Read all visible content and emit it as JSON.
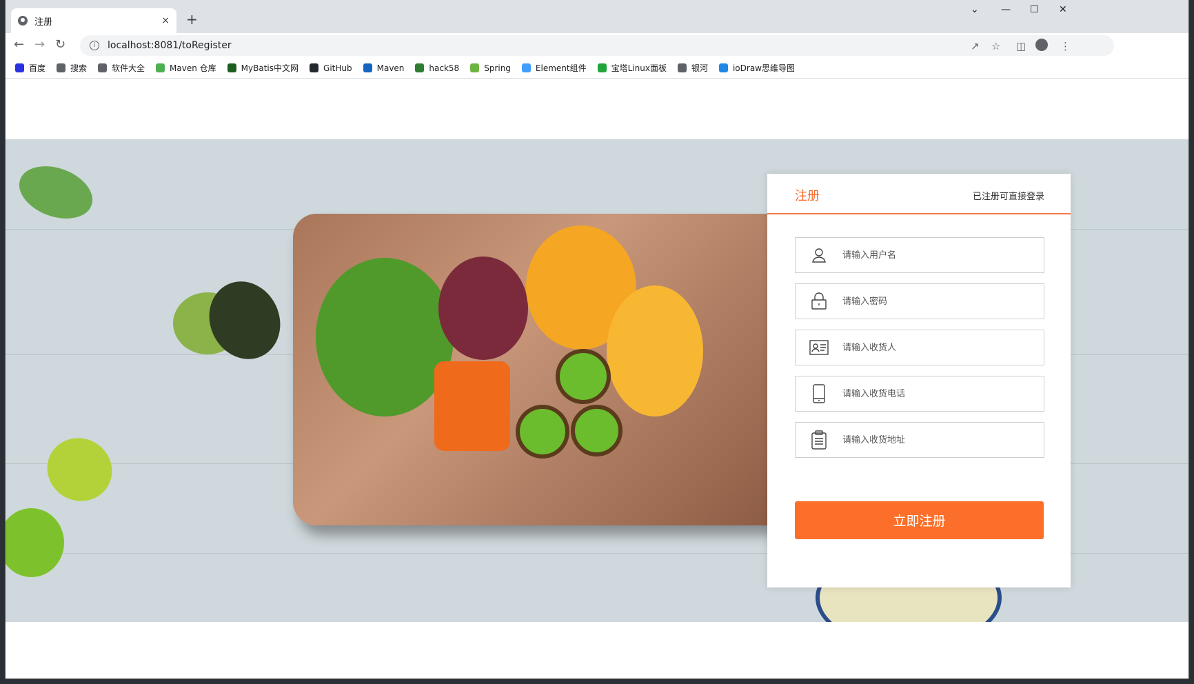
{
  "browser": {
    "tab_title": "注册",
    "tab_close": "×",
    "new_tab": "+",
    "url": "localhost:8081/toRegister",
    "window_controls": [
      "⌄",
      "—",
      "☐",
      "✕"
    ]
  },
  "bookmarks": [
    {
      "label": "百度",
      "color": "#2932e1"
    },
    {
      "label": "搜索",
      "color": "#5f6368"
    },
    {
      "label": "软件大全",
      "color": "#5f6368"
    },
    {
      "label": "Maven 仓库",
      "color": "#4caf50"
    },
    {
      "label": "MyBatis中文网",
      "color": "#1b5e20"
    },
    {
      "label": "GitHub",
      "color": "#24292e"
    },
    {
      "label": "Maven",
      "color": "#1565c0"
    },
    {
      "label": "hack58",
      "color": "#2e7d32"
    },
    {
      "label": "Spring",
      "color": "#6db33f"
    },
    {
      "label": "Element组件",
      "color": "#409eff"
    },
    {
      "label": "宝塔Linux面板",
      "color": "#20a53a"
    },
    {
      "label": "银河",
      "color": "#5f6368"
    },
    {
      "label": "ioDraw思维导图",
      "color": "#1e88e5"
    }
  ],
  "register": {
    "title": "注册",
    "login_link": "已注册可直接登录",
    "fields": [
      {
        "icon": "user-icon",
        "placeholder": "请输入用户名"
      },
      {
        "icon": "lock-icon",
        "placeholder": "请输入密码"
      },
      {
        "icon": "id-card-icon",
        "placeholder": "请输入收货人"
      },
      {
        "icon": "phone-icon",
        "placeholder": "请输入收货电话"
      },
      {
        "icon": "clipboard-icon",
        "placeholder": "请输入收货地址"
      }
    ],
    "submit_label": "立即注册",
    "accent": "#fc6f2a"
  }
}
